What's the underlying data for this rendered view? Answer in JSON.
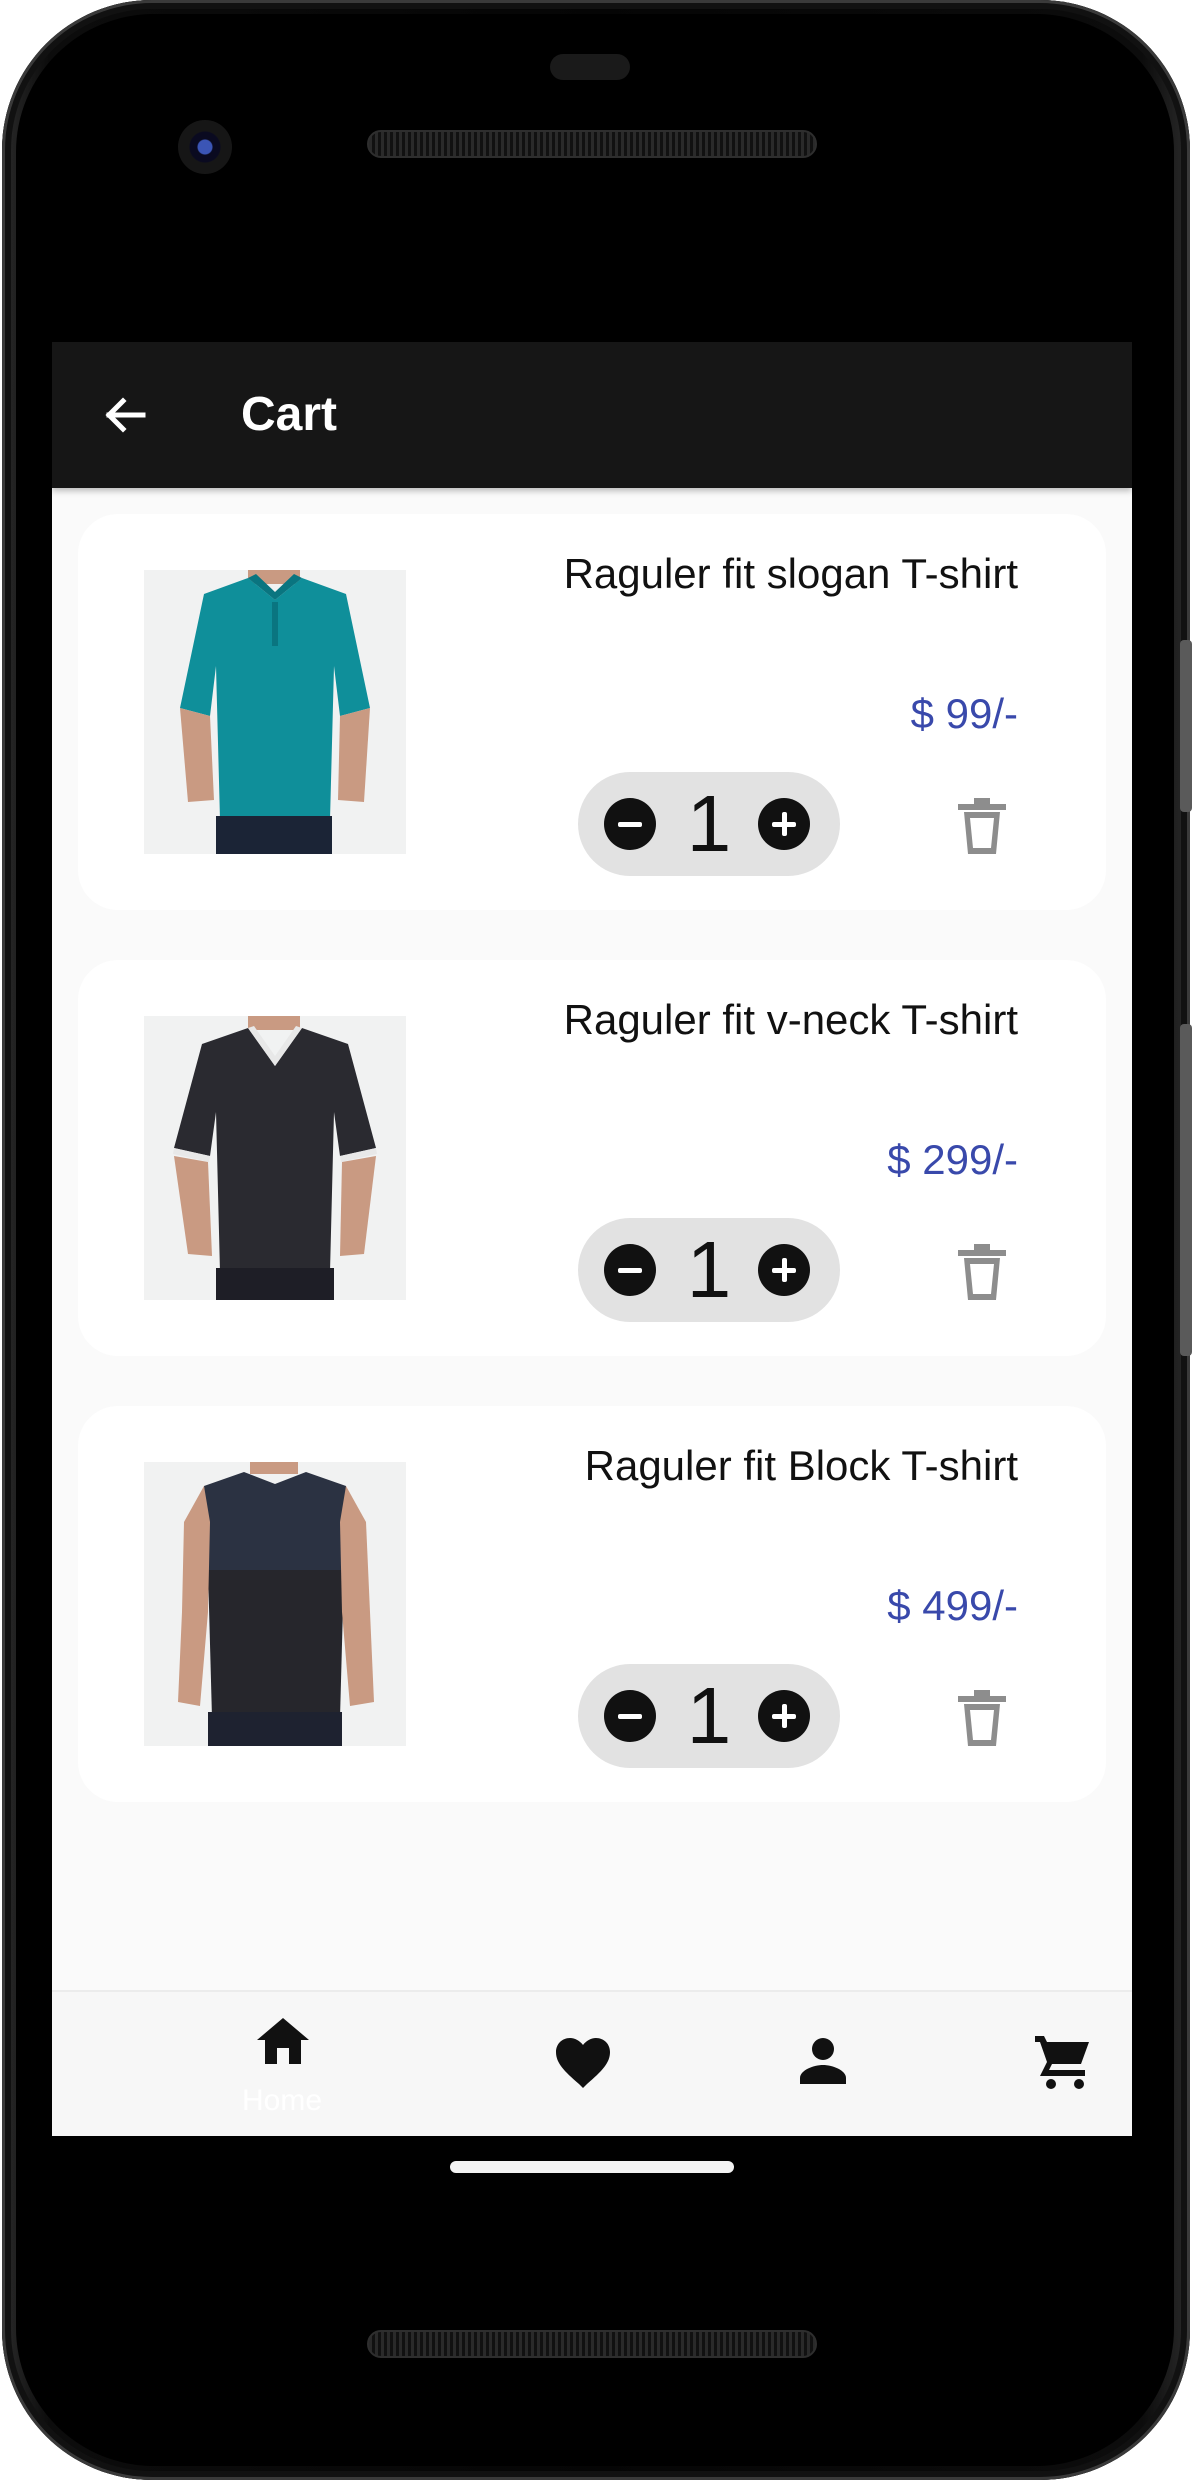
{
  "header": {
    "title": "Cart"
  },
  "cart": {
    "items": [
      {
        "name": "Raguler fit slogan T-shirt",
        "price": "$ 99/-",
        "quantity": "1",
        "image": "teal polo shirt photo"
      },
      {
        "name": "Raguler fit v-neck  T-shirt",
        "price": "$ 299/-",
        "quantity": "1",
        "image": "black v-neck t-shirt photo"
      },
      {
        "name": "Raguler fit Block T-shirt",
        "price": "$ 499/-",
        "quantity": "1",
        "image": "black sleeveless shirt photo"
      }
    ]
  },
  "bottom_nav": {
    "items": [
      {
        "label": "Home",
        "icon": "home-icon"
      },
      {
        "label": "",
        "icon": "heart-icon"
      },
      {
        "label": "",
        "icon": "person-icon"
      },
      {
        "label": "",
        "icon": "cart-icon"
      }
    ]
  },
  "colors": {
    "app_bar": "#161616",
    "price": "#3949ab",
    "background": "#fafafa"
  }
}
